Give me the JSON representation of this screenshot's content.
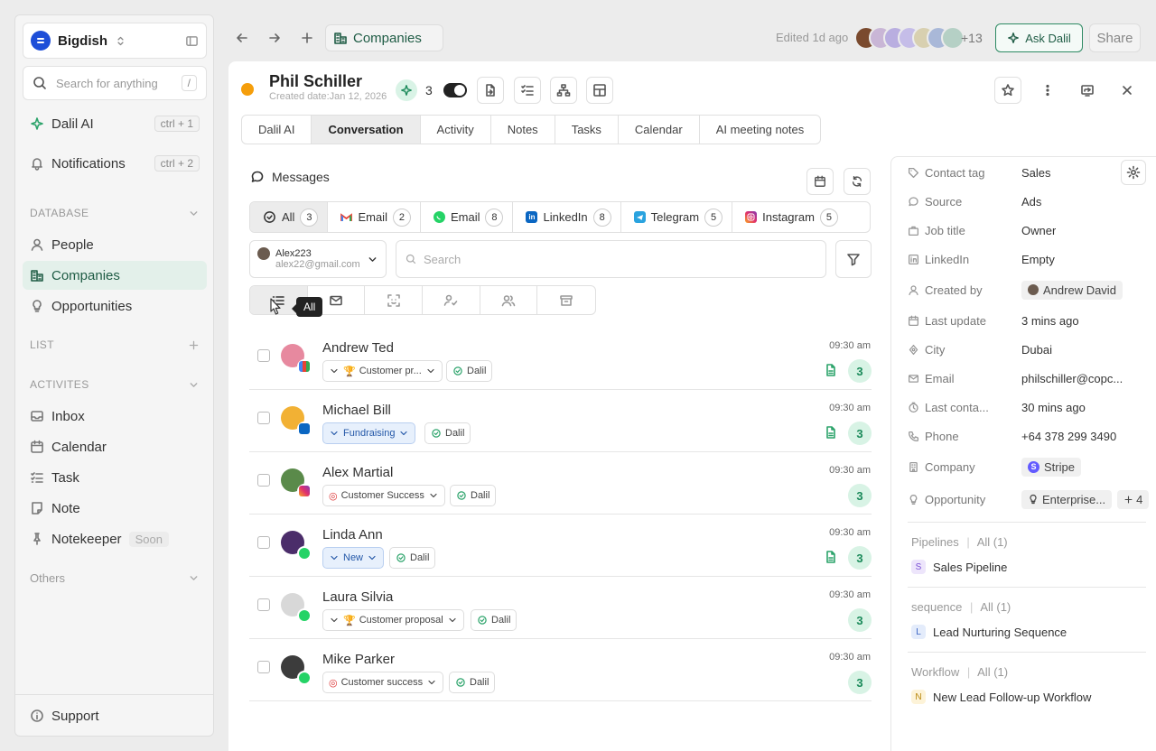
{
  "workspace": {
    "name": "Bigdish"
  },
  "search": {
    "placeholder": "Search for anything",
    "shortcut": "/"
  },
  "nav_top": [
    {
      "label": "Dalil AI",
      "shortcut": "ctrl + 1"
    },
    {
      "label": "Notifications",
      "shortcut": "ctrl + 2"
    }
  ],
  "sections": {
    "database": "DATABASE",
    "list": "LIST",
    "activites": "ACTIVITES",
    "others": "Others"
  },
  "database_items": [
    "People",
    "Companies",
    "Opportunities"
  ],
  "activity_items": [
    "Inbox",
    "Calendar",
    "Task",
    "Note",
    "Notekeeper"
  ],
  "soon_label": "Soon",
  "support_label": "Support",
  "topbar": {
    "breadcrumb": "Companies",
    "edited": "Edited 1d ago",
    "more_count": "+13",
    "ask_label": "Ask Dalil",
    "share_label": "Share"
  },
  "record": {
    "name": "Phil Schiller",
    "created": "Created date:Jan 12, 2026",
    "ai_count": "3"
  },
  "tabs": [
    "Dalil AI",
    "Conversation",
    "Activity",
    "Notes",
    "Tasks",
    "Calendar",
    "AI meeting notes"
  ],
  "messages_title": "Messages",
  "channels": [
    {
      "label": "All",
      "count": "3"
    },
    {
      "label": "Email",
      "count": "2"
    },
    {
      "label": "Email",
      "count": "8"
    },
    {
      "label": "LinkedIn",
      "count": "8"
    },
    {
      "label": "Telegram",
      "count": "5"
    },
    {
      "label": "Instagram",
      "count": "5"
    }
  ],
  "account": {
    "name": "Alex223",
    "email": "alex22@gmail.com"
  },
  "message_search": {
    "placeholder": "Search"
  },
  "tooltip": "All",
  "conversations": [
    {
      "name": "Andrew Ted",
      "tag": "Customer pr...",
      "agent": "Dalil",
      "time": "09:30 am",
      "count": "3"
    },
    {
      "name": "Michael Bill",
      "tag": "Fundraising",
      "agent": "Dalil",
      "time": "09:30 am",
      "count": "3"
    },
    {
      "name": "Alex Martial",
      "tag": "Customer Success",
      "agent": "Dalil",
      "time": "09:30 am",
      "count": "3"
    },
    {
      "name": "Linda Ann",
      "tag": "New",
      "agent": "Dalil",
      "time": "09:30 am",
      "count": "3"
    },
    {
      "name": "Laura Silvia",
      "tag": "Customer proposal",
      "agent": "Dalil",
      "time": "09:30 am",
      "count": "3"
    },
    {
      "name": "Mike Parker",
      "tag": "Customer success",
      "agent": "Dalil",
      "time": "09:30 am",
      "count": "3"
    }
  ],
  "properties": [
    {
      "label": "Contact tag",
      "value": "Sales"
    },
    {
      "label": "Source",
      "value": "Ads"
    },
    {
      "label": "Job title",
      "value": "Owner"
    },
    {
      "label": "LinkedIn",
      "value": "Empty"
    },
    {
      "label": "Created by",
      "value": "Andrew David"
    },
    {
      "label": "Last update",
      "value": "3 mins ago"
    },
    {
      "label": "City",
      "value": "Dubai"
    },
    {
      "label": "Email",
      "value": "philschiller@copc..."
    },
    {
      "label": "Last conta...",
      "value": "30 mins ago"
    },
    {
      "label": "Phone",
      "value": "+64 378 299 3490"
    },
    {
      "label": "Company",
      "value": "Stripe"
    },
    {
      "label": "Opportunity",
      "value": "Enterprise...",
      "extra": "4"
    }
  ],
  "groups": [
    {
      "title": "Pipelines",
      "filter": "All (1)",
      "badge": "S",
      "item": "Sales Pipeline"
    },
    {
      "title": "sequence",
      "filter": "All (1)",
      "badge": "L",
      "item": "Lead Nurturing Sequence"
    },
    {
      "title": "Workflow",
      "filter": "All (1)",
      "badge": "N",
      "item": "New Lead Follow-up Workflow"
    }
  ],
  "colors": {
    "accent": "#1f5c45",
    "active_nav": "#e3f0ea",
    "count_badge": "#d8f3e5"
  }
}
